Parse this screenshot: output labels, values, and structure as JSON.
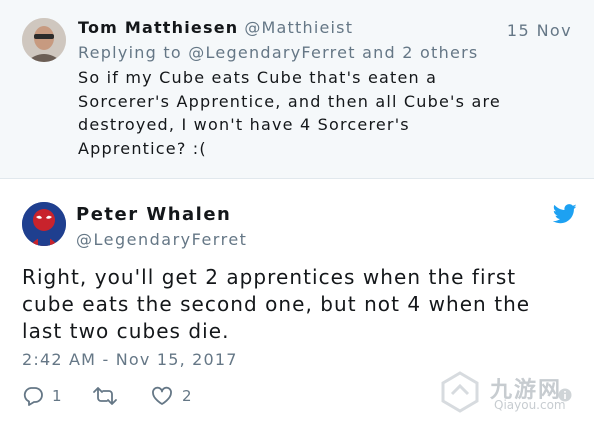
{
  "reply_tweet": {
    "author_name": "Tom Matthiesen",
    "author_handle": "@Matthieist",
    "date": "15 Nov",
    "replying_to": "Replying to @LegendaryFerret and 2 others",
    "text": "So if my Cube eats Cube that's eaten a\nSorcerer's Apprentice, and then all Cube's are\ndestroyed, I won't have 4 Sorcerer's\nApprentice? :("
  },
  "main_tweet": {
    "author_name": "Peter Whalen",
    "author_handle": "@LegendaryFerret",
    "text": "Right, you'll get 2 apprentices when the first\ncube eats the second one, but not 4 when the\nlast two cubes die.",
    "timestamp": "2:42 AM - Nov 15, 2017",
    "actions": {
      "reply_count": "1",
      "retweet_count": "",
      "like_count": "2"
    }
  },
  "colors": {
    "reply_background": "#f5f8fa",
    "secondary_text": "#657786",
    "primary_text": "#14171a",
    "twitter_blue": "#1da1f2"
  },
  "icons": {
    "brand": "twitter-bird-icon",
    "reply": "reply-icon",
    "retweet": "retweet-icon",
    "like": "heart-icon"
  },
  "watermark": {
    "brand": "九游网",
    "url": "Qiayou.com"
  }
}
